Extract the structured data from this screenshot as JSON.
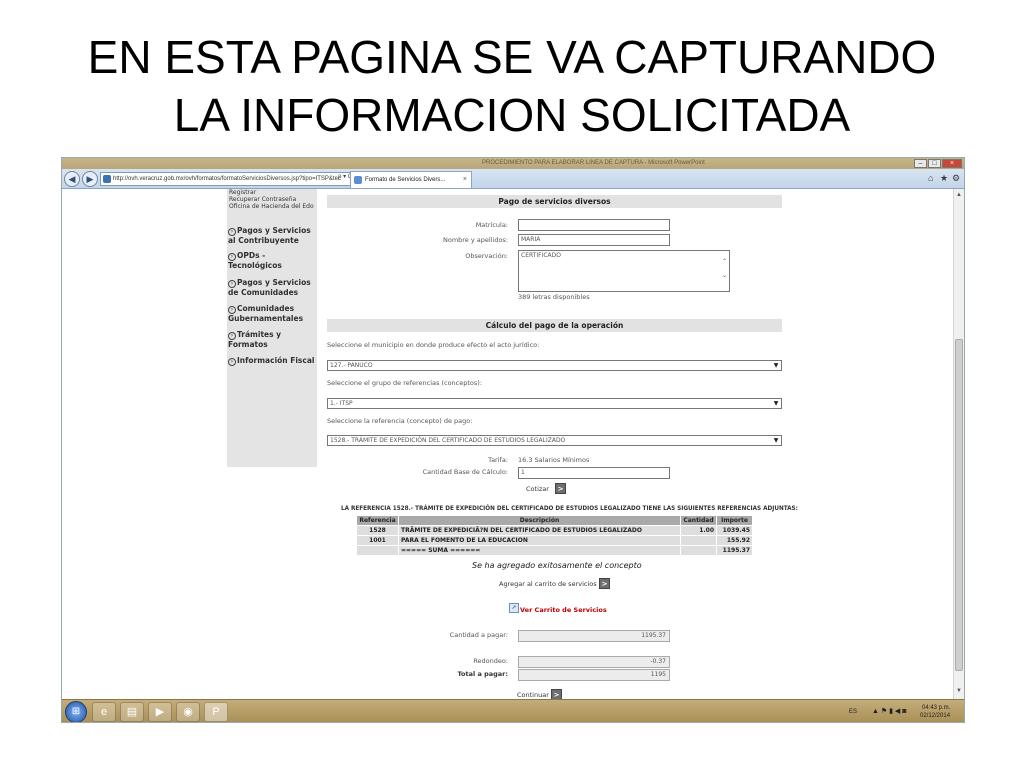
{
  "slide": {
    "title_line1": "EN ESTA PAGINA SE VA CAPTURANDO",
    "title_line2": "LA INFORMACION SOLICITADA"
  },
  "browser": {
    "address": "http://ovh.veracruz.gob.mx/ovh/formatos/formatoServiciosDiversos.jsp?tipo=ITSP&tec",
    "address_tools": "ρ ▾ C",
    "tab1_label": "",
    "tab2_label": "Formato de Servicios Divers...",
    "tab_close": "×",
    "window_title": "PROCEDIMIENTO PARA ELABORAR LINEA DE CAPTURA - Microsoft PowerPoint",
    "icons": [
      "back-icon",
      "forward-icon",
      "home-icon",
      "star-icon",
      "gear-icon"
    ]
  },
  "sidebar": {
    "links": [
      "Registrar",
      "Recuperar Contraseña",
      "Oficina de Hacienda del Edo"
    ],
    "items": [
      {
        "line1": "Pagos y Servicios",
        "line2": "al Contribuyente"
      },
      {
        "line1": "OPDs -",
        "line2": "Tecnológicos"
      },
      {
        "line1": "Pagos y Servicios",
        "line2": "de Comunidades"
      },
      {
        "line1": "Comunidades",
        "line2": "Gubernamentales"
      },
      {
        "line1": "Trámites y",
        "line2": "Formatos"
      },
      {
        "line1": "Información Fiscal",
        "line2": ""
      }
    ]
  },
  "form": {
    "section1_title": "Pago de servicios diversos",
    "matricula_label": "Matrícula:",
    "matricula_value": "",
    "nombre_label": "Nombre y apellidos:",
    "nombre_value": "MARIA",
    "observacion_label": "Observación:",
    "observacion_value": "CERTIFICADO",
    "letters_left": "389 letras disponibles",
    "section2_title": "Cálculo del pago de la operación",
    "municipio_label": "Seleccione el municipio en donde produce efecto el acto jurídico:",
    "municipio_value": "127.- PANUCO",
    "grupo_label": "Seleccione el grupo de referencias (conceptos):",
    "grupo_value": "1.- ITSP",
    "referencia_label": "Seleccione la referencia (concepto) de pago:",
    "referencia_value": "1528.- TRÁMITE DE EXPEDICIÓN DEL CERTIFICADO DE ESTUDIOS LEGALIZADO",
    "tarifa_label": "Tarifa:",
    "tarifa_value": "16.3 Salarios Mínimos",
    "cantidad_base_label": "Cantidad Base de Cálculo:",
    "cantidad_base_value": "1",
    "cotizar_label": "Cotizar"
  },
  "references": {
    "heading": "LA REFERENCIA 1528.- TRÁMITE DE EXPEDICIÓN DEL CERTIFICADO DE ESTUDIOS LEGALIZADO TIENE LAS SIGUIENTES REFERENCIAS ADJUNTAS:",
    "columns": [
      "Referencia",
      "Descripción",
      "Cantidad",
      "Importe"
    ],
    "rows": [
      [
        "1528",
        "TRÃMITE DE EXPEDICIÃ?N DEL CERTIFICADO DE ESTUDIOS LEGALIZADO",
        "1.00",
        "1039.45"
      ],
      [
        "1001",
        "PARA EL FOMENTO DE LA EDUCACION",
        "",
        "155.92"
      ],
      [
        "",
        "===== SUMA ======",
        "",
        "1195.37"
      ]
    ],
    "success_msg": "Se ha agregado exitosamente el concepto",
    "add_cart_label": "Agregar al carrito de servicios",
    "view_cart_label": "Ver Carrito de Servicios"
  },
  "totals": {
    "cantidad_label": "Cantidad a pagar:",
    "cantidad_value": "1195.37",
    "redondeo_label": "Redondeo:",
    "redondeo_value": "-0.37",
    "total_label": "Total a pagar:",
    "total_value": "1195",
    "continuar_label": "Continuar"
  },
  "taskbar": {
    "lang": "ES",
    "time": "04:43 p.m.",
    "date": "02/12/2014"
  }
}
